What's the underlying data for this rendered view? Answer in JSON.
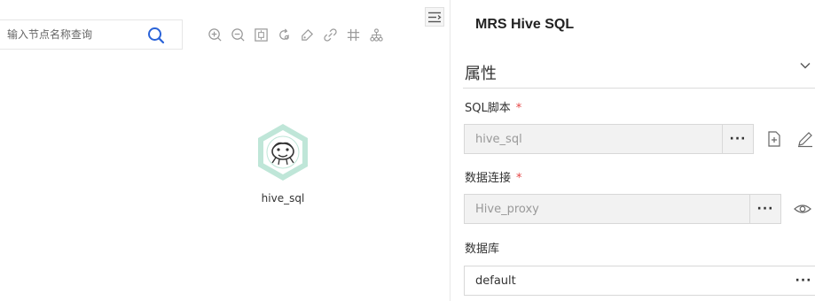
{
  "search": {
    "placeholder": "输入节点名称查询"
  },
  "toolbar": {
    "tools": [
      "zoom-in-icon",
      "zoom-out-icon",
      "fit-screen-icon",
      "refresh-icon",
      "tag-icon",
      "link-icon",
      "grid-icon",
      "tree-icon"
    ]
  },
  "canvas": {
    "node": {
      "label": "hive_sql",
      "icon": "hive-icon",
      "ring_color": "#bfe6d8"
    }
  },
  "panel": {
    "title": "MRS Hive SQL",
    "section": {
      "title": "属性"
    },
    "fields": [
      {
        "label": "SQL脚本",
        "required_mark": "*",
        "value": "hive_sql",
        "more": "···"
      },
      {
        "label": "数据连接",
        "required_mark": "*",
        "value": "Hive_proxy",
        "more": "···"
      },
      {
        "label": "数据库",
        "value": "default",
        "more": "···"
      }
    ]
  },
  "colors": {
    "accent": "#1a73e8",
    "required": "#e54545",
    "node_ring": "#bfe6d8"
  }
}
